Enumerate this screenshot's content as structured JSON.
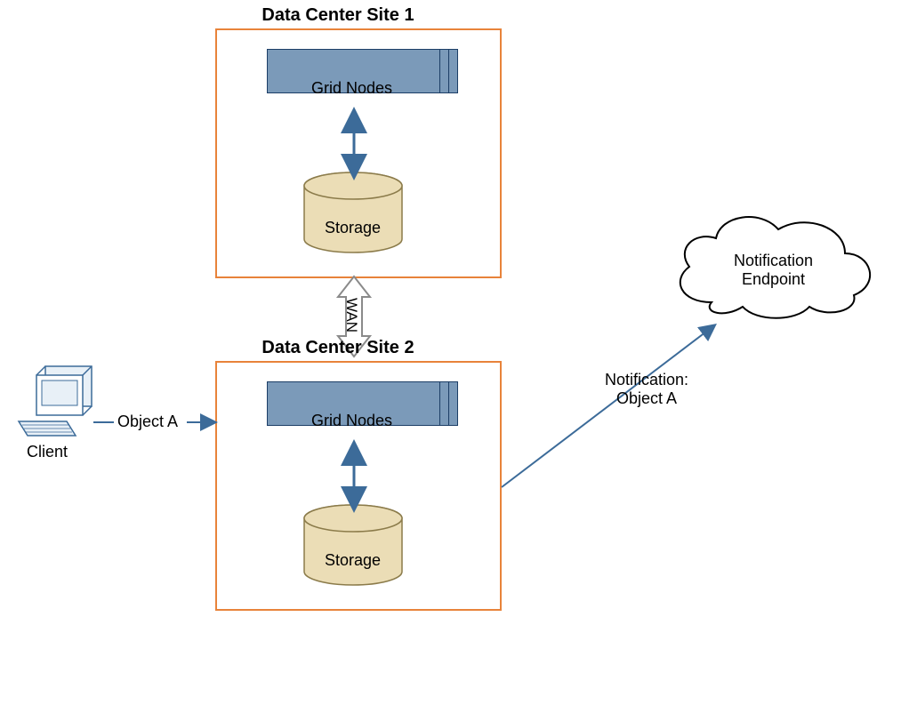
{
  "diagram": {
    "site1": {
      "title": "Data Center Site 1",
      "grid_nodes": "Grid Nodes",
      "storage": "Storage"
    },
    "site2": {
      "title": "Data Center Site 2",
      "grid_nodes": "Grid Nodes",
      "storage": "Storage"
    },
    "wan_label": "WAN",
    "client": {
      "label": "Client",
      "object_label": "Object A"
    },
    "notification": {
      "label_line1": "Notification:",
      "label_line2": "Object A",
      "endpoint_line1": "Notification",
      "endpoint_line2": "Endpoint"
    },
    "colors": {
      "site_border": "#E8833A",
      "grid_fill": "#7B9AB9",
      "grid_border": "#1C3E66",
      "storage_fill": "#EBDDB6",
      "storage_border": "#8B7B4A",
      "arrow_blue": "#3C6B99",
      "client_fill": "#E8F0F7",
      "client_border": "#3C6B99"
    }
  }
}
